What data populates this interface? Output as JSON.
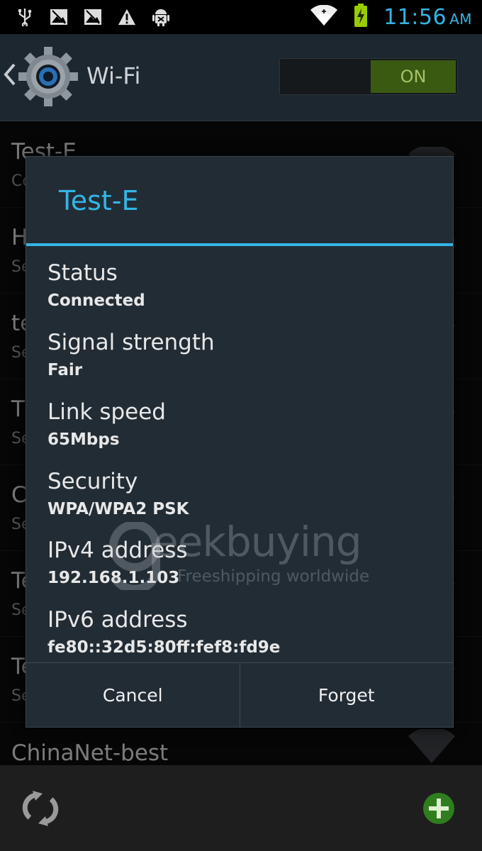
{
  "status_bar": {
    "icons": [
      "usb-icon",
      "image-icon",
      "image-icon",
      "warning-icon",
      "android-debug-icon",
      "wifi-signal-icon",
      "battery-charging-icon"
    ],
    "time": "11:56",
    "ampm": "AM",
    "colors": {
      "clock": "#33b5e5",
      "battery": "#99cc00"
    }
  },
  "action_bar": {
    "title": "Wi-Fi",
    "toggle_label": "ON",
    "colors": {
      "toggle_on": "#3a5a12"
    }
  },
  "networks": [
    {
      "name": "Test-E",
      "sub": "Co"
    },
    {
      "name": "H",
      "sub": "Se"
    },
    {
      "name": "te",
      "sub": "Se"
    },
    {
      "name": "T",
      "sub": "Se"
    },
    {
      "name": "C",
      "sub": "Se"
    },
    {
      "name": "Te",
      "sub": "Se"
    },
    {
      "name": "Te",
      "sub": "Se"
    },
    {
      "name": "ChinaNet-best",
      "sub": ""
    }
  ],
  "dialog": {
    "title": "Test-E",
    "fields": [
      {
        "label": "Status",
        "value": "Connected"
      },
      {
        "label": "Signal strength",
        "value": "Fair"
      },
      {
        "label": "Link speed",
        "value": "65Mbps"
      },
      {
        "label": "Security",
        "value": "WPA/WPA2 PSK"
      },
      {
        "label": "IPv4 address",
        "value": "192.168.1.103"
      },
      {
        "label": "IPv6 address",
        "value": "fe80::32d5:80ff:fef8:fd9e"
      }
    ],
    "cancel_label": "Cancel",
    "forget_label": "Forget",
    "colors": {
      "accent": "#33b5e5"
    }
  },
  "watermark": {
    "brand": "eekbuying",
    "tagline": "Freeshipping worldwide"
  }
}
